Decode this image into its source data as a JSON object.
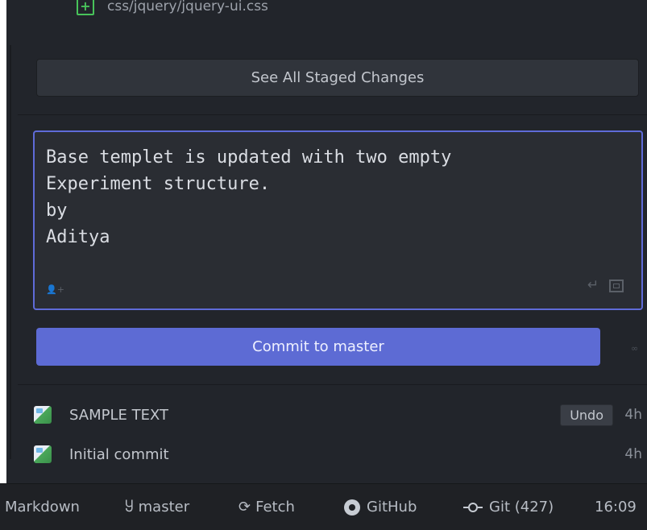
{
  "staged_file": {
    "name": "css/jquery/jquery-ui.css",
    "status_icon": "plus-square-icon",
    "status_color": "#48c35a"
  },
  "see_all_label": "See All Staged Changes",
  "commit_message": "Base templet is updated with two empty\nExperiment structure.\nby\nAditya",
  "commit_button_label": "Commit to master",
  "accent_color": "#5d6bd4",
  "infinity_glyph": "∞",
  "recent_commits": [
    {
      "title": "SAMPLE TEXT",
      "time": "4h",
      "undo_label": "Undo"
    },
    {
      "title": "Initial commit",
      "time": "4h"
    }
  ],
  "status_bar": {
    "grammar": "Markdown",
    "branch": "master",
    "fetch": "Fetch",
    "github": "GitHub",
    "git": "Git (427)",
    "clock": "16:09"
  }
}
